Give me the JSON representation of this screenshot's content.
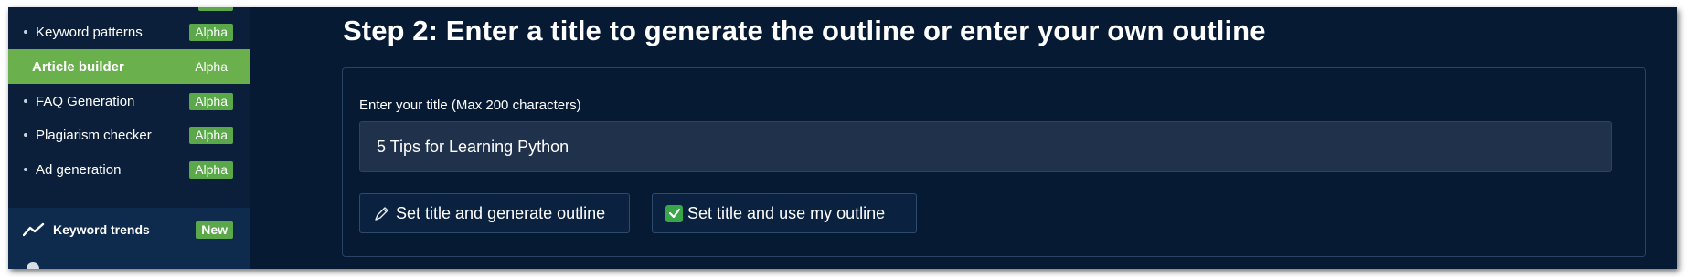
{
  "sidebar": {
    "items": [
      {
        "label": "Keyword patterns",
        "badge": "Alpha"
      },
      {
        "label": "Article builder",
        "badge": "Alpha"
      },
      {
        "label": "FAQ Generation",
        "badge": "Alpha"
      },
      {
        "label": "Plagiarism checker",
        "badge": "Alpha"
      },
      {
        "label": "Ad generation",
        "badge": "Alpha"
      }
    ],
    "active_item": "Article builder",
    "trends": {
      "label": "Keyword trends",
      "badge": "New",
      "icon": "trend-line-icon"
    }
  },
  "main": {
    "heading": "Step 2: Enter a title to generate the outline or enter your own outline",
    "title_field": {
      "label": "Enter your title (Max 200 characters)",
      "value": "5 Tips for Learning Python"
    },
    "buttons": {
      "generate": {
        "label": "Set title and generate outline",
        "icon": "pen-icon"
      },
      "own_outline": {
        "label": "Set title and use my outline",
        "icon": "checkmark-icon"
      }
    }
  },
  "colors": {
    "background": "#061a33",
    "sidebar": "#0b1f3a",
    "accent_green": "#6ab04c",
    "badge_green": "#5aa84a",
    "input_bg": "#1f314b"
  }
}
